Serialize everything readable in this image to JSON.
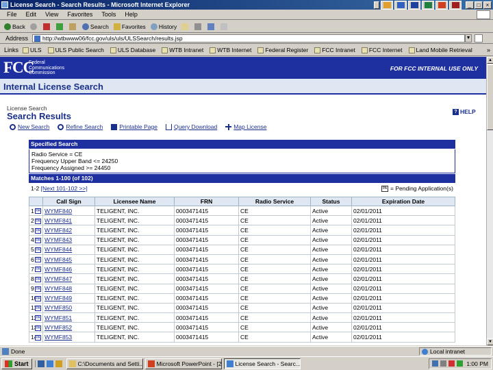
{
  "window": {
    "title": "License Search - Search Results - Microsoft Internet Explorer",
    "controls": {
      "minimize": "_",
      "maximize": "□",
      "close": "×"
    }
  },
  "menu": [
    "File",
    "Edit",
    "View",
    "Favorites",
    "Tools",
    "Help"
  ],
  "toolbar": {
    "back": "Back",
    "search": "Search",
    "favorites": "Favorites",
    "history": "History"
  },
  "address": {
    "label": "Address",
    "url": "http://wtbwww06/fcc.gov/uls/uls/ULSSearch/results.jsp"
  },
  "links": {
    "label": "Links",
    "items": [
      "ULS",
      "ULS Public Search",
      "ULS Database",
      "WTB Intranet",
      "WTB Internet",
      "Federal Register",
      "FCC Intranet",
      "FCC Internet",
      "Land Mobile Retrieval"
    ],
    "more": "»"
  },
  "banner": {
    "logo": "FCC",
    "name_line1": "Federal",
    "name_line2": "Communications",
    "name_line3": "Commission",
    "internal_notice": "FOR FCC INTERNAL USE ONLY"
  },
  "page": {
    "strip_title": "Internal License Search",
    "breadcrumb": "License Search",
    "title": "Search Results",
    "help": "HELP"
  },
  "actions": {
    "new_search": "New Search",
    "refine_search": "Refine Search",
    "printable_page": "Printable Page",
    "query_download": "Query Download",
    "map_license": "Map License"
  },
  "specified": {
    "header": "Specified Search",
    "line1": "Radio Service = CE",
    "line2": "Frequency Upper Band <= 24250",
    "line3": "Frequency Assigned >= 24450"
  },
  "matches": {
    "header": "Matches 1-100 (of 102)",
    "pager_current": "1-2",
    "pager_next": "[Next 101-102 >>]",
    "pending_label": "= Pending Application(s)"
  },
  "table": {
    "columns": [
      "",
      "Call Sign",
      "Licensee Name",
      "FRN",
      "Radio Service",
      "Status",
      "Expiration Date"
    ],
    "rows": [
      {
        "n": "1",
        "call": "WYMF840",
        "name": "TELIGENT, INC.",
        "frn": "0003471415",
        "svc": "CE",
        "status": "Active",
        "exp": "02/01/2011"
      },
      {
        "n": "2",
        "call": "WYMF841",
        "name": "TELIGENT, INC.",
        "frn": "0003471415",
        "svc": "CE",
        "status": "Active",
        "exp": "02/01/2011"
      },
      {
        "n": "3",
        "call": "WYMF842",
        "name": "TELIGENT, INC.",
        "frn": "0003471415",
        "svc": "CE",
        "status": "Active",
        "exp": "02/01/2011"
      },
      {
        "n": "4",
        "call": "WYMF843",
        "name": "TELIGENT, INC.",
        "frn": "0003471415",
        "svc": "CE",
        "status": "Active",
        "exp": "02/01/2011"
      },
      {
        "n": "5",
        "call": "WYMF844",
        "name": "TELIGENT, INC.",
        "frn": "0003471415",
        "svc": "CE",
        "status": "Active",
        "exp": "02/01/2011"
      },
      {
        "n": "6",
        "call": "WYMF845",
        "name": "TELIGENT, INC.",
        "frn": "0003471415",
        "svc": "CE",
        "status": "Active",
        "exp": "02/01/2011"
      },
      {
        "n": "7",
        "call": "WYMF846",
        "name": "TELIGENT, INC.",
        "frn": "0003471415",
        "svc": "CE",
        "status": "Active",
        "exp": "02/01/2011"
      },
      {
        "n": "8",
        "call": "WYMF847",
        "name": "TELIGENT, INC.",
        "frn": "0003471415",
        "svc": "CE",
        "status": "Active",
        "exp": "02/01/2011"
      },
      {
        "n": "9",
        "call": "WYMF848",
        "name": "TELIGENT, INC.",
        "frn": "0003471415",
        "svc": "CE",
        "status": "Active",
        "exp": "02/01/2011"
      },
      {
        "n": "10",
        "call": "WYMF849",
        "name": "TELIGENT, INC.",
        "frn": "0003471415",
        "svc": "CE",
        "status": "Active",
        "exp": "02/01/2011"
      },
      {
        "n": "11",
        "call": "WYMF850",
        "name": "TELIGENT, INC.",
        "frn": "0003471415",
        "svc": "CE",
        "status": "Active",
        "exp": "02/01/2011"
      },
      {
        "n": "12",
        "call": "WYMF851",
        "name": "TELIGENT, INC.",
        "frn": "0003471415",
        "svc": "CE",
        "status": "Active",
        "exp": "02/01/2011"
      },
      {
        "n": "13",
        "call": "WYMF852",
        "name": "TELIGENT, INC.",
        "frn": "0003471415",
        "svc": "CE",
        "status": "Active",
        "exp": "02/01/2011"
      },
      {
        "n": "14",
        "call": "WYMF853",
        "name": "TELIGENT, INC.",
        "frn": "0003471415",
        "svc": "CE",
        "status": "Active",
        "exp": "02/01/2011"
      }
    ]
  },
  "status": {
    "text": "Done",
    "zone": "Local intranet"
  },
  "taskbar": {
    "start": "Start",
    "tasks": [
      "C:\\Documents and Setti...",
      "Microsoft PowerPoint - [2...",
      "License Search - Searc..."
    ],
    "clock": "1:00 PM"
  },
  "colors": {
    "fcc_blue": "#1e2fa0",
    "strip_bg": "#dfe8f2",
    "link": "#1a2f8c",
    "chrome": "#d4d0c8"
  }
}
